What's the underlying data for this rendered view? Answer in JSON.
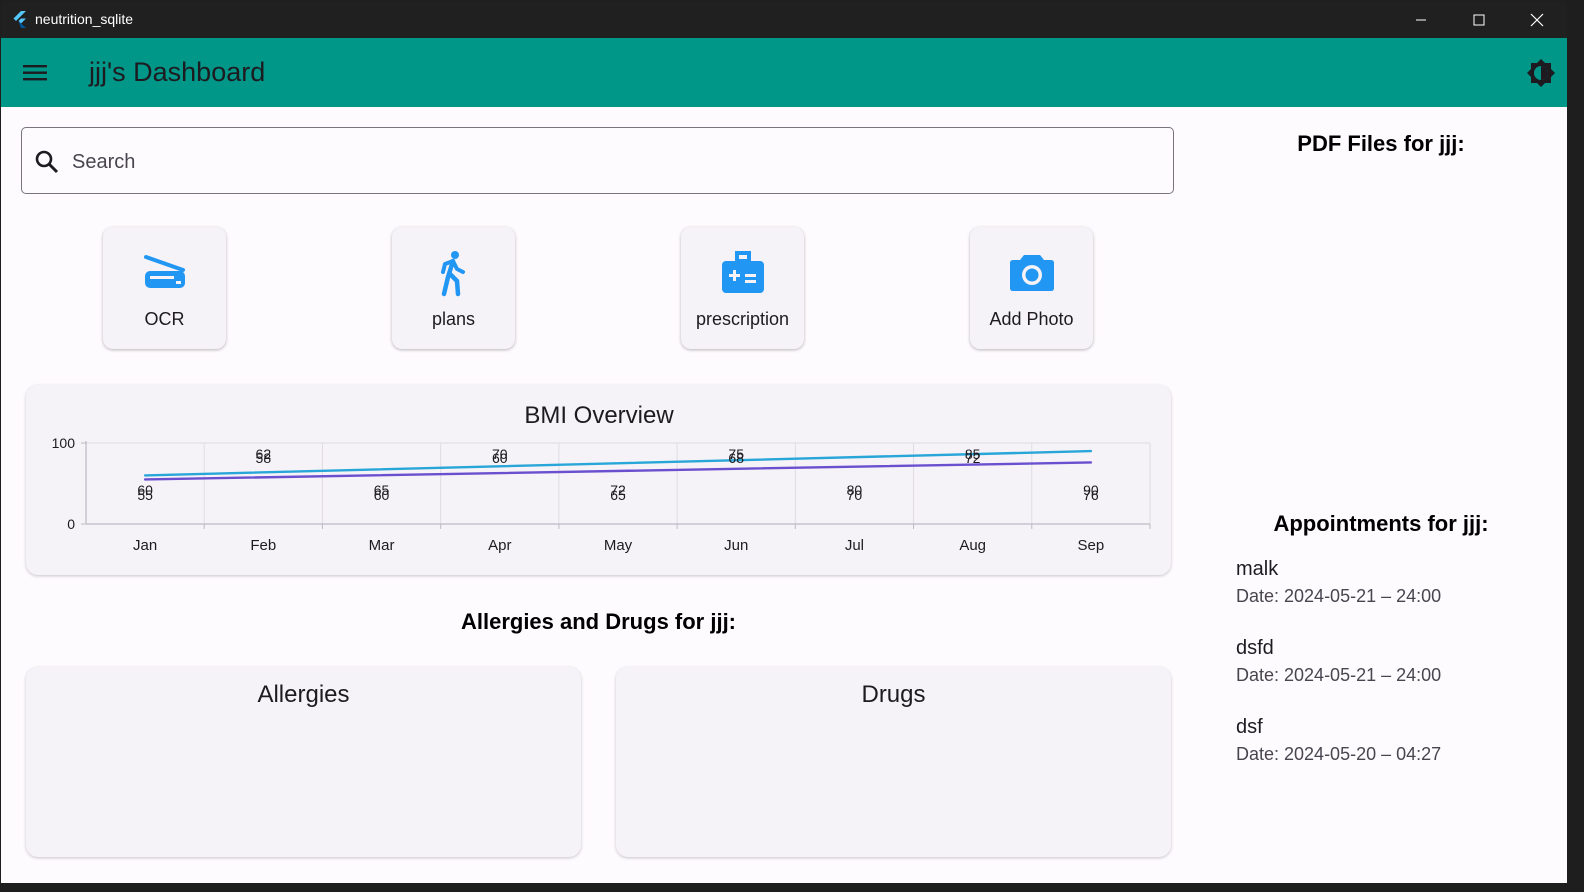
{
  "window": {
    "title": "neutrition_sqlite"
  },
  "appbar": {
    "title": "jjj's Dashboard"
  },
  "search": {
    "placeholder": "Search"
  },
  "actions": [
    {
      "label": "OCR",
      "icon": "scanner-icon"
    },
    {
      "label": "plans",
      "icon": "walk-icon"
    },
    {
      "label": "prescription",
      "icon": "medical-kit-icon"
    },
    {
      "label": "Add Photo",
      "icon": "camera-icon"
    }
  ],
  "colors": {
    "appbar": "#009688",
    "accent": "#2196f3",
    "line1": "#29a6d8",
    "line2": "#6a4fcf"
  },
  "chart_data": {
    "type": "line",
    "title": "BMI Overview",
    "categories": [
      "Jan",
      "Feb",
      "Mar",
      "Apr",
      "May",
      "Jun",
      "Jul",
      "Aug",
      "Sep"
    ],
    "yticks": [
      "0",
      "100"
    ],
    "ylim": [
      0,
      100
    ],
    "grid": true,
    "series": [
      {
        "values": [
          60,
          62,
          65,
          70,
          72,
          75,
          80,
          85,
          90
        ]
      },
      {
        "values": [
          55,
          58,
          60,
          60,
          65,
          68,
          70,
          72,
          76
        ]
      }
    ]
  },
  "allergy_section": {
    "heading": "Allergies and Drugs for jjj:",
    "allergies_title": "Allergies",
    "drugs_title": "Drugs"
  },
  "sidebar": {
    "pdf_heading": "PDF Files for jjj:",
    "appointments_heading": "Appointments for jjj:",
    "appointments": [
      {
        "name": "malk",
        "date": "Date: 2024-05-21 – 24:00"
      },
      {
        "name": "dsfd",
        "date": "Date: 2024-05-21 – 24:00"
      },
      {
        "name": "dsf",
        "date": "Date: 2024-05-20 – 04:27"
      }
    ]
  }
}
